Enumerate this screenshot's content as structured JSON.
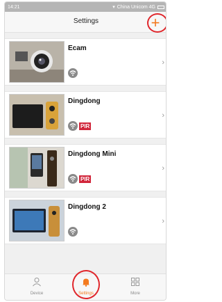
{
  "status_bar": {
    "time": "14:21",
    "carrier": "China Unicom 4G"
  },
  "header": {
    "title": "Settings",
    "add_icon": "plus-icon"
  },
  "devices": [
    {
      "name": "Ecam",
      "pir": ""
    },
    {
      "name": "Dingdong",
      "pir": "PIR"
    },
    {
      "name": "Dingdong Mini",
      "pir": "PIR"
    },
    {
      "name": "Dingdong 2",
      "pir": ""
    }
  ],
  "tabs": [
    {
      "label": "Device",
      "icon": "person-icon"
    },
    {
      "label": "Settings",
      "icon": "bell-icon"
    },
    {
      "label": "More",
      "icon": "grid-icon"
    }
  ],
  "colors": {
    "accent": "#f37a1f",
    "highlight": "#e0262b",
    "pir": "#d1263b"
  }
}
